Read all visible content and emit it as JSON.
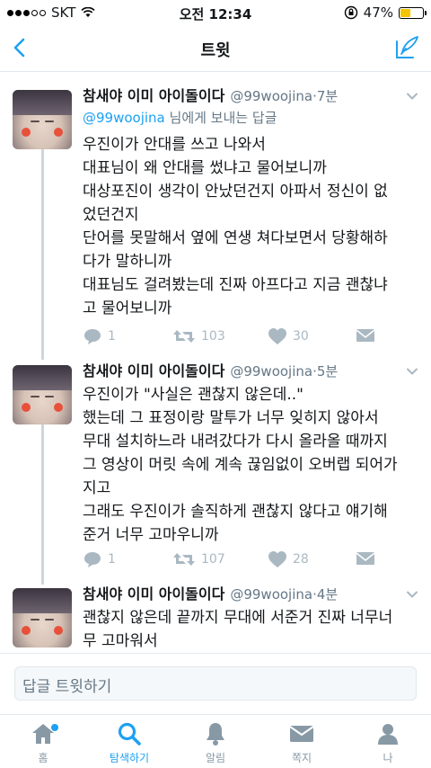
{
  "status_bar": {
    "carrier": "SKT",
    "time": "오전 12:34",
    "battery": "47%",
    "battery_level": 0.47
  },
  "nav": {
    "title": "트윗"
  },
  "tweets": [
    {
      "name": "참새야 이미 아이돌이다",
      "handle": "@99woojina",
      "sep": "·",
      "age": "7분",
      "reply_to_mention": "@99woojina",
      "reply_to_suffix": " 님에게 보내는 답글",
      "lines": [
        "우진이가 안대를 쓰고 나와서",
        "대표님이 왜 안대를 썼냐고 물어보니까",
        "대상포진이 생각이 안났던건지 아파서 정신이 없",
        "었던건지",
        "단어를 못말해서 옆에 연생 쳐다보면서 당황해하",
        "다가 말하니까",
        "대표님도 걸려봤는데 진짜 아프다고 지금 괜찮냐",
        "고 물어보니까"
      ],
      "replies": "1",
      "retweets": "103",
      "likes": "30"
    },
    {
      "name": "참새야 이미 아이돌이다",
      "handle": "@99woojina",
      "sep": "·",
      "age": "5분",
      "lines": [
        "우진이가 \"사실은 괜찮지 않은데..\"",
        "했는데 그 표정이랑 말투가 너무 잊히지 않아서",
        "무대 설치하느라 내려갔다가 다시 올라올 때까지",
        "그 영상이 머릿 속에 계속 끊임없이 오버랩 되어가",
        "지고",
        "그래도 우진이가 솔직하게 괜찮지 않다고 얘기해",
        "준거 너무 고마우니까"
      ],
      "replies": "1",
      "retweets": "107",
      "likes": "28"
    },
    {
      "name": "참새야 이미 아이돌이다",
      "handle": "@99woojina",
      "sep": "·",
      "age": "4분",
      "lines": [
        "괜찮지 않은데 끝까지 무대에 서준거 진짜 너무너",
        "무 고마워서"
      ]
    }
  ],
  "reply_bar": {
    "placeholder": "답글 트윗하기"
  },
  "tabs": [
    {
      "label": "홈",
      "icon": "home-icon",
      "active": false
    },
    {
      "label": "탐색하기",
      "icon": "search-icon",
      "active": true
    },
    {
      "label": "알림",
      "icon": "bell-icon",
      "active": false
    },
    {
      "label": "쪽지",
      "icon": "envelope-icon",
      "active": false
    },
    {
      "label": "나",
      "icon": "person-icon",
      "active": false
    }
  ],
  "colors": {
    "accent": "#1da1f2",
    "muted": "#657786",
    "action_gray": "#aab8c2",
    "battery": "#f5c400"
  }
}
